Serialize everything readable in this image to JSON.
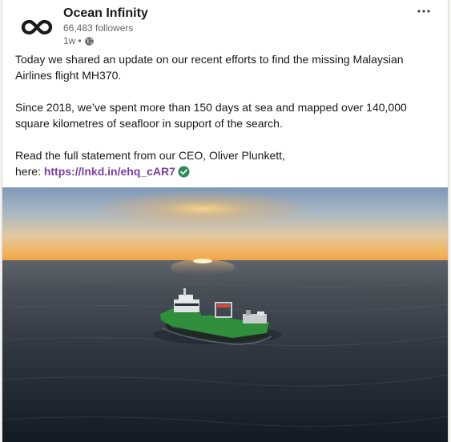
{
  "post": {
    "author": {
      "name": "Ocean Infinity",
      "followers": "66,483 followers",
      "time": "1w",
      "separator": "•"
    },
    "more_icon": "ellipsis-icon",
    "paragraphs": {
      "p1": "Today we shared an update on our recent efforts to find the missing Malaysian Airlines flight MH370.",
      "p2": "Since 2018, we’ve spent more than 150 days at sea and mapped over 140,000 square kilometres of seafloor in support of the search.",
      "p3_line1": "Read the full statement from our CEO, Oliver Plunkett,",
      "p3_prefix": "here: ",
      "link": "https://lnkd.in/ehq_cAR7"
    },
    "colors": {
      "link": "#7a3fa3",
      "verified": "#2e8b57",
      "ship_hull": "#2f8f3a"
    }
  }
}
